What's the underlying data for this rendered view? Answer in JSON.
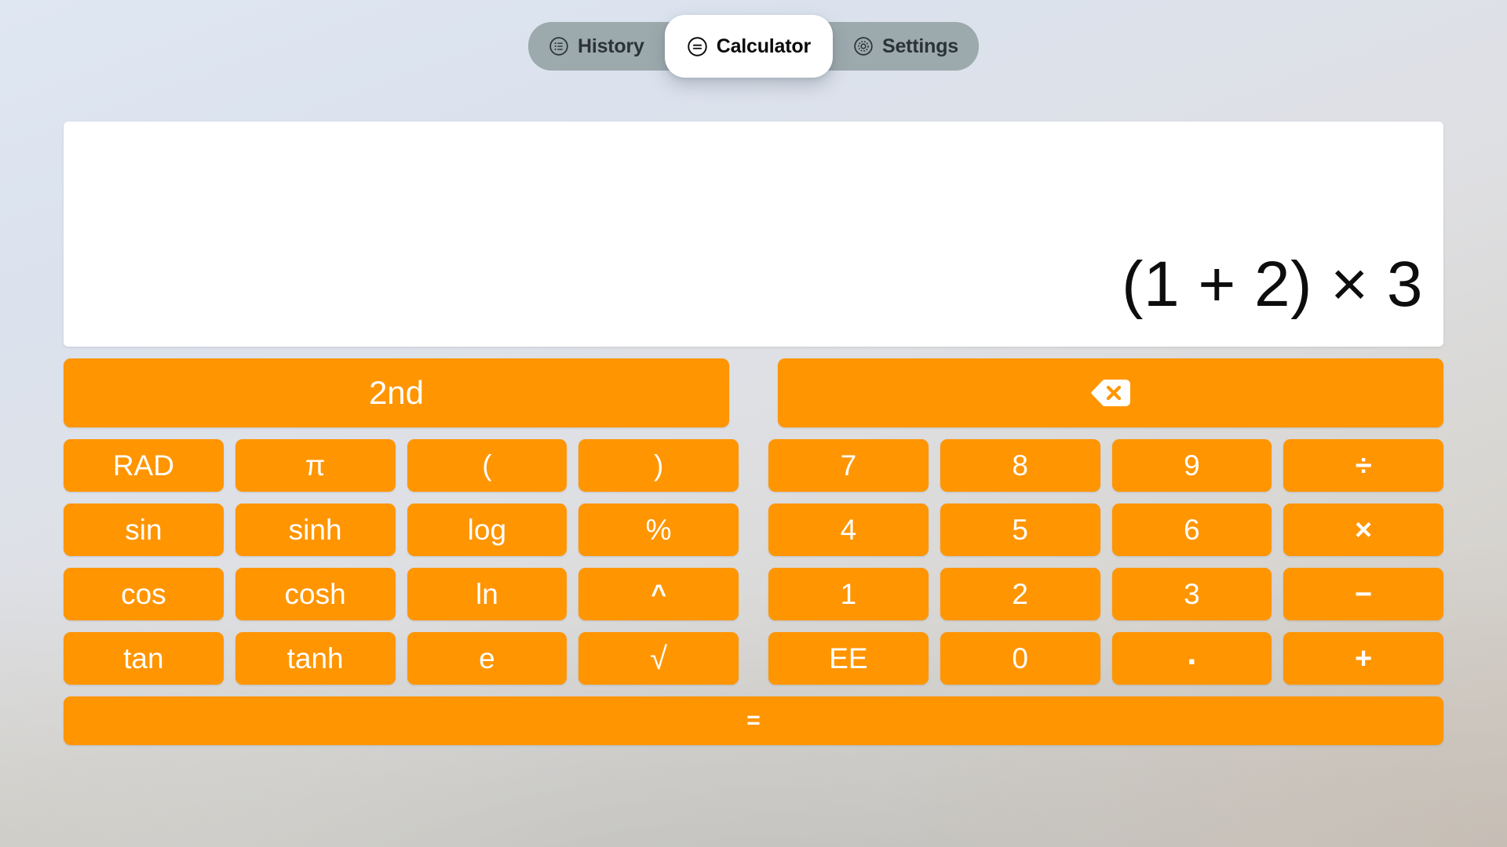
{
  "app": {
    "title": "Calculator",
    "accent_color": "#FF9500",
    "button_text_color": "#FFFFFF",
    "tabbar_color": "#9CA9AD",
    "active_tab_color": "#FFFFFF",
    "display_background": "#FFFFFF"
  },
  "tabs": [
    {
      "id": "history",
      "label": "History",
      "icon": "list-circle-icon",
      "active": false
    },
    {
      "id": "calculator",
      "label": "Calculator",
      "icon": "equals-circle-icon",
      "active": true
    },
    {
      "id": "settings",
      "label": "Settings",
      "icon": "gear-circle-icon",
      "active": false
    }
  ],
  "display": {
    "expression": "(1 + 2) × 3"
  },
  "keypad": {
    "top_row": {
      "second_label": "2nd",
      "backspace_icon": "backspace-icon"
    },
    "rows": [
      {
        "sci": [
          "RAD",
          "π",
          "(",
          ")"
        ],
        "num": [
          "7",
          "8",
          "9",
          "÷"
        ]
      },
      {
        "sci": [
          "sin",
          "sinh",
          "log",
          "%"
        ],
        "num": [
          "4",
          "5",
          "6",
          "×"
        ]
      },
      {
        "sci": [
          "cos",
          "cosh",
          "ln",
          "^"
        ],
        "num": [
          "1",
          "2",
          "3",
          "−"
        ]
      },
      {
        "sci": [
          "tan",
          "tanh",
          "e",
          "√"
        ],
        "num": [
          "EE",
          "0",
          ".",
          "+"
        ]
      }
    ],
    "equals_label": "="
  }
}
